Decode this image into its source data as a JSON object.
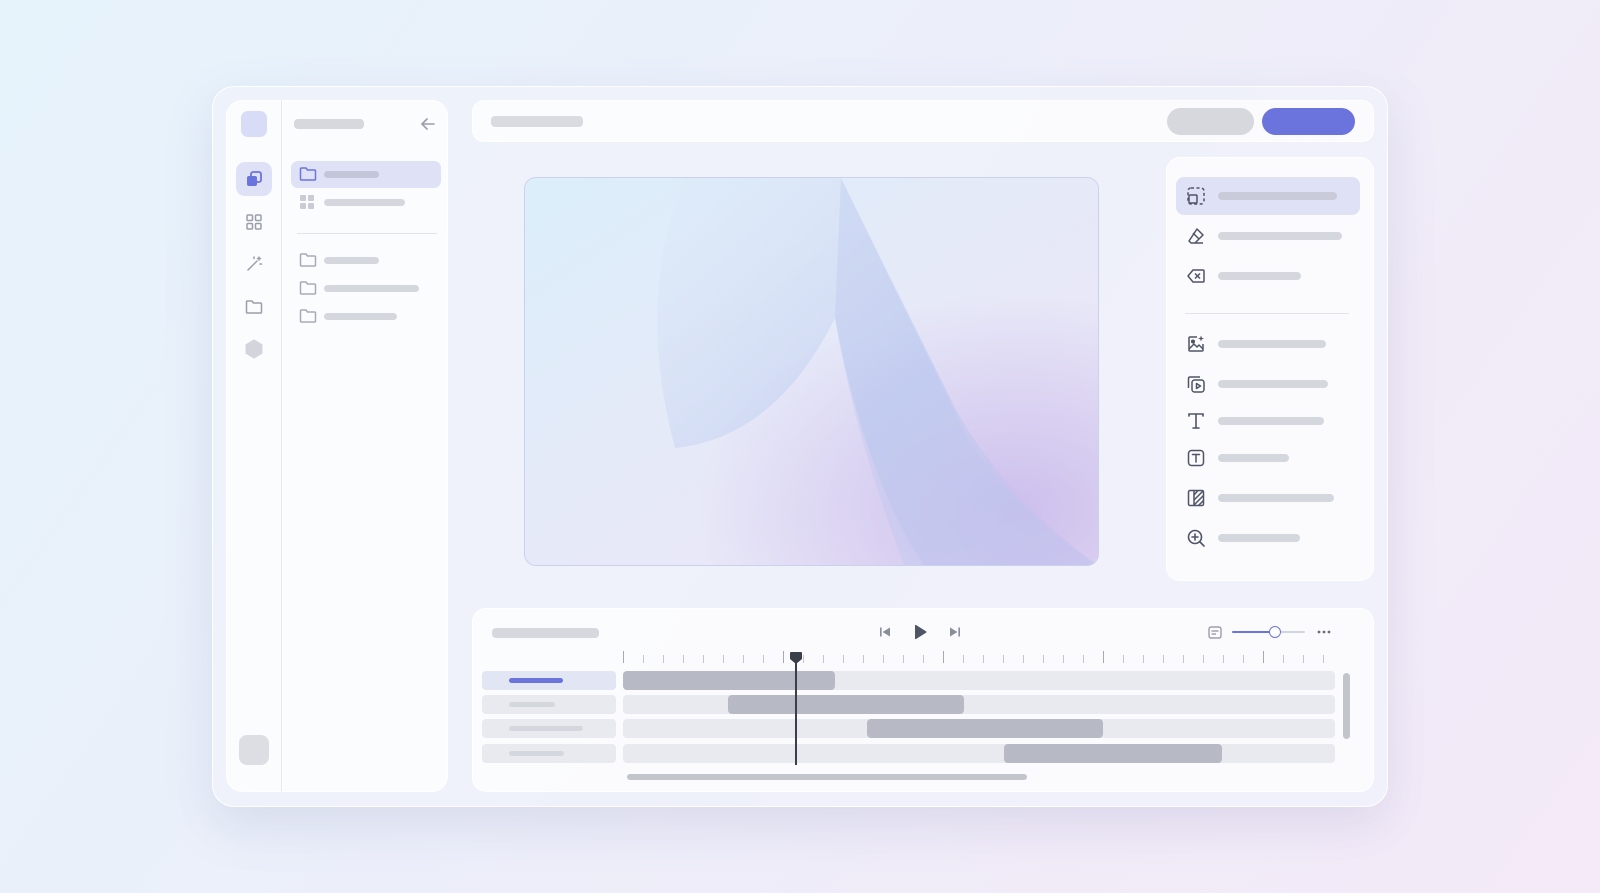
{
  "colors": {
    "accent": "#6b73dc",
    "accent_soft": "#dfe2f7",
    "placeholder": "#d5d7de",
    "clip": "#b7b9c4",
    "playhead": "#3b3f4c"
  },
  "icons": {
    "rail": [
      "layers-icon",
      "grid-icon",
      "magic-wand-icon",
      "folder-icon",
      "hexagon-icon"
    ],
    "sidebar": [
      "folder-icon",
      "grid-icon",
      "folder-icon",
      "folder-icon",
      "folder-icon"
    ],
    "tools": [
      "selection-icon",
      "eraser-icon",
      "clear-icon",
      "image-sparkle-icon",
      "video-copy-icon",
      "text-icon",
      "text-box-icon",
      "texture-icon",
      "zoom-in-icon"
    ],
    "transport": [
      "skip-back-icon",
      "play-icon",
      "skip-forward-icon"
    ],
    "timeline_tools": [
      "caption-icon",
      "more-icon"
    ]
  },
  "timeline": {
    "zoom_level": 0.6,
    "playhead_fraction": 0.245,
    "horizontal_scroll_fraction": 0.56
  }
}
